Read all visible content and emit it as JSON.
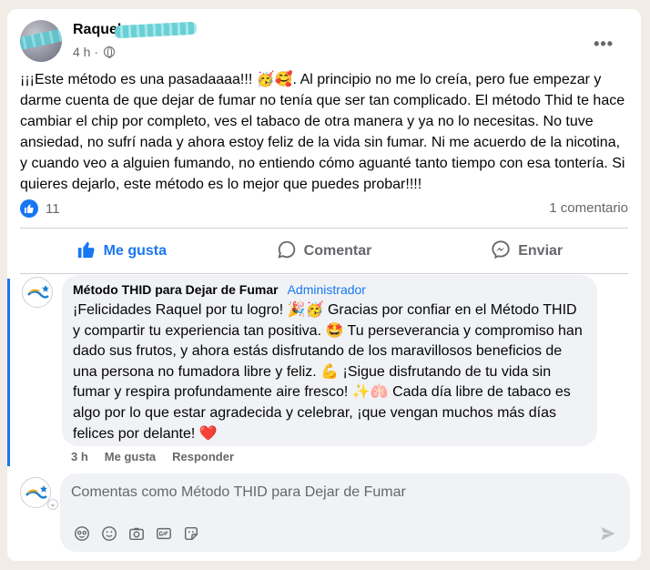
{
  "post": {
    "author": "Raquel",
    "time": "4 h ·",
    "more_label": "•••",
    "text": "¡¡¡Este método es una pasadaaaa!!! 🥳🥰. Al principio no me lo creía, pero fue empezar y darme cuenta de que dejar de fumar no tenía que ser tan complicado. El método Thid te hace cambiar el chip por completo, ves el tabaco de otra manera y ya no lo necesitas. No tuve ansiedad, no sufrí nada y ahora estoy feliz de la vida sin fumar. Ni me acuerdo de la nicotina, y cuando veo a alguien fumando, no entiendo cómo aguanté tanto tiempo con esa tontería. Si quieres dejarlo, este método es lo mejor que puedes probar!!!!",
    "reaction_count": "11",
    "comment_count": "1 comentario"
  },
  "actions": {
    "like": "Me gusta",
    "comment": "Comentar",
    "share": "Enviar"
  },
  "comment": {
    "author": "Método THID para Dejar de Fumar",
    "role": "Administrador",
    "text": "¡Felicidades Raquel por tu logro! 🎉🥳 Gracias por confiar en el Método THID y compartir tu experiencia tan positiva. 🤩 Tu perseverancia y compromiso han dado sus frutos, y ahora estás disfrutando de los maravillosos beneficios de una persona no fumadora libre y feliz. 💪 ¡Sigue disfrutando de tu vida sin fumar y respira profundamente aire fresco! ✨🫁 Cada día libre de tabaco es algo por lo que estar agradecida y celebrar, ¡que vengan muchos más días felices por delante! ❤️",
    "time": "3 h",
    "like": "Me gusta",
    "reply": "Responder"
  },
  "reply_box": {
    "placeholder": "Comentas como Método THID para Dejar de Fumar"
  },
  "colors": {
    "accent": "#1877f2",
    "muted": "#65676b"
  }
}
